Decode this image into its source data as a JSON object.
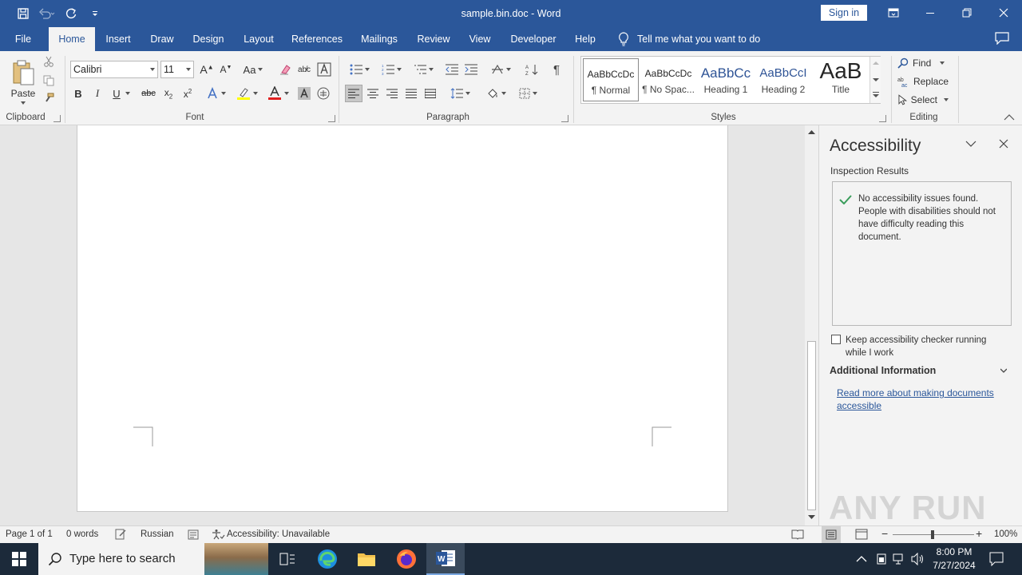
{
  "window": {
    "title": "sample.bin.doc - Word",
    "sign_in": "Sign in"
  },
  "tabs": [
    "File",
    "Home",
    "Insert",
    "Draw",
    "Design",
    "Layout",
    "References",
    "Mailings",
    "Review",
    "View",
    "Developer",
    "Help"
  ],
  "active_tab": "Home",
  "tell_me": "Tell me what you want to do",
  "ribbon": {
    "clipboard": {
      "paste": "Paste",
      "label": "Clipboard"
    },
    "font": {
      "name": "Calibri",
      "size": "11",
      "label": "Font",
      "change_case": "Aa"
    },
    "paragraph": {
      "label": "Paragraph"
    },
    "styles": {
      "label": "Styles",
      "items": [
        {
          "sample": "AaBbCcDc",
          "name": "¶ Normal"
        },
        {
          "sample": "AaBbCcDc",
          "name": "¶ No Spac..."
        },
        {
          "sample": "AaBbCc",
          "name": "Heading 1"
        },
        {
          "sample": "AaBbCcI",
          "name": "Heading 2"
        },
        {
          "sample": "AaB",
          "name": "Title"
        }
      ]
    },
    "editing": {
      "find": "Find",
      "replace": "Replace",
      "select": "Select",
      "label": "Editing"
    }
  },
  "accessibility_pane": {
    "title": "Accessibility",
    "inspection_results": "Inspection Results",
    "result_message": "No accessibility issues found. People with disabilities should not have difficulty reading this document.",
    "keep_running": "Keep accessibility checker running while I work",
    "keep_running_checked": false,
    "additional_info": "Additional Information",
    "link": "Read more about making documents accessible"
  },
  "status_bar": {
    "page": "Page 1 of 1",
    "words": "0 words",
    "language": "Russian",
    "accessibility": "Accessibility: Unavailable",
    "zoom": "100%"
  },
  "taskbar": {
    "search_placeholder": "Type here to search",
    "time": "8:00 PM",
    "date": "7/27/2024"
  },
  "colors": {
    "word_blue": "#2b579a",
    "ribbon_bg": "#f3f3f3",
    "taskbar": "#1c2a3a"
  },
  "watermark": "ANY RUN"
}
